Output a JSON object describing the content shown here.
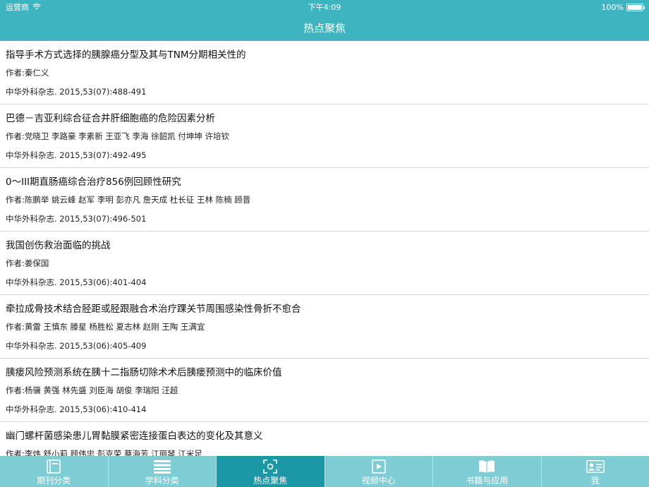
{
  "status_bar": {
    "carrier": "运营商",
    "time": "下午4:09",
    "battery": "100%",
    "battery_level": 1.0
  },
  "nav": {
    "title": "热点聚焦"
  },
  "articles": [
    {
      "title": "指导手术方式选择的胰腺癌分型及其与TNM分期相关性的",
      "authors": "作者:秦仁义",
      "source": "中华外科杂志. 2015,53(07):488-491"
    },
    {
      "title": "巴德－吉亚利综合征合并肝细胞癌的危险因素分析",
      "authors": "作者:党晓卫 李路豪 李素新 王亚飞 李海 徐韶凯 付坤坤 许培钦",
      "source": "中华外科杂志. 2015,53(07):492-495"
    },
    {
      "title": "0～III期直肠癌综合治疗856例回顾性研究",
      "authors": "作者:陈鹏举 姚云峰 赵军 李明 彭亦凡 詹天成 杜长征 王林 陈楠 顾晋",
      "source": "中华外科杂志. 2015,53(07):496-501"
    },
    {
      "title": "我国创伤救治面临的挑战",
      "authors": "作者:姜保国",
      "source": "中华外科杂志. 2015,53(06):401-404"
    },
    {
      "title": "牵拉成骨技术结合胫距或胫跟融合术治疗踝关节周围感染性骨折不愈合",
      "authors": "作者:黄雷 王慎东 滕星 杨胜松 夏志林 赵刚 王陶 王满宜",
      "source": "中华外科杂志. 2015,53(06):405-409"
    },
    {
      "title": "胰瘘风险预测系统在胰十二指肠切除术术后胰瘘预测中的临床价值",
      "authors": "作者:杨骥 黄强 林先盛 刘臣海 胡俊 李瑞阳 汪超",
      "source": "中华外科杂志. 2015,53(06):410-414"
    },
    {
      "title": "幽门螺杆菌感染患儿胃黏膜紧密连接蛋白表达的变化及其意义",
      "authors": "作者:李炜 舒小莉 顾伟忠 彭克荣 蔡海芳 江丽琴 江米足",
      "source": ""
    }
  ],
  "tabs": [
    {
      "label": "期刊分类",
      "icon": "book-icon"
    },
    {
      "label": "学科分类",
      "icon": "list-icon"
    },
    {
      "label": "热点聚焦",
      "icon": "focus-icon"
    },
    {
      "label": "视频中心",
      "icon": "video-icon"
    },
    {
      "label": "书籍与应用",
      "icon": "open-book-icon"
    },
    {
      "label": "我",
      "icon": "profile-card-icon"
    }
  ],
  "colors": {
    "nav_background": "#3fb4c1",
    "tab_background": "#7ecdd5",
    "tab_active": "#1c97a6"
  }
}
